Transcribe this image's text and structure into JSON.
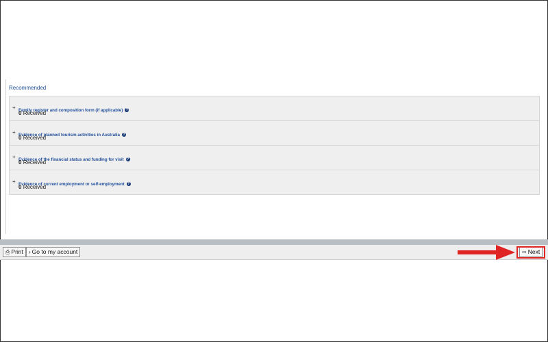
{
  "recommended": {
    "title": "Recommended",
    "items": [
      {
        "expander": "+",
        "title": "Family register and composition form (if applicable)",
        "count": "0",
        "status": "Received"
      },
      {
        "expander": "+",
        "title": "Evidence of planned tourism activities in Australia",
        "count": "0",
        "status": "Received"
      },
      {
        "expander": "+",
        "title": "Evidence of the financial status and funding for visit",
        "count": "0",
        "status": "Received"
      },
      {
        "expander": "+",
        "title": "Evidence of current employment or self-employment",
        "count": "0",
        "status": "Received"
      }
    ]
  },
  "footer": {
    "print_label": "Print",
    "account_label": "Go to my account",
    "next_label": "Next",
    "print_icon": "printer-icon",
    "account_icon": "chevron-right-icon",
    "next_icon": "arrow-right-outline-icon"
  },
  "colors": {
    "link": "#1f4e9a",
    "annotation": "#e02424",
    "separator": "#b9bdc4"
  },
  "annotation": {
    "type": "red-arrow-and-box",
    "target": "next-button"
  }
}
